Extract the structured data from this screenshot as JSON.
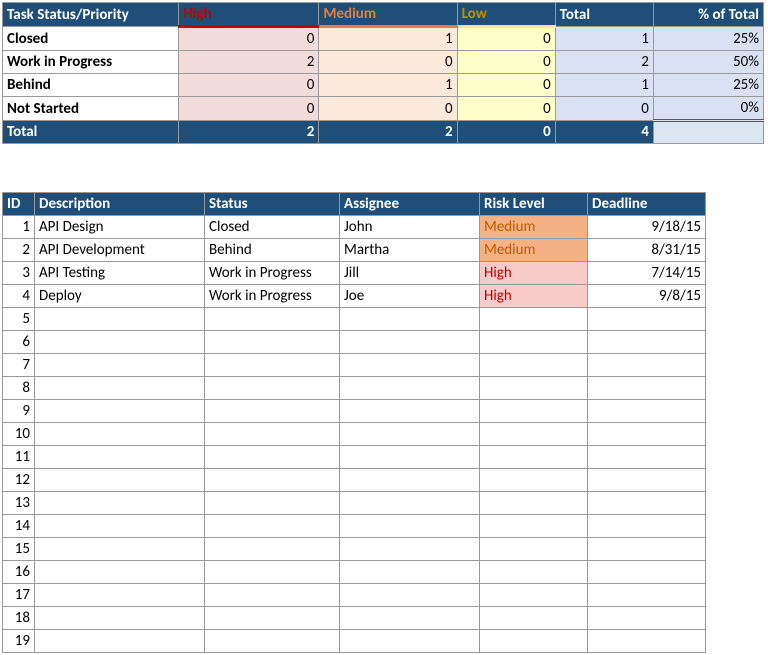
{
  "summary": {
    "headers": {
      "task": "Task Status/Priority",
      "high": "High",
      "medium": "Medium",
      "low": "Low",
      "total": "Total",
      "pct": "% of Total"
    },
    "rows": [
      {
        "label": "Closed",
        "high": "0",
        "medium": "1",
        "low": "0",
        "total": "1",
        "pct": "25%"
      },
      {
        "label": "Work in Progress",
        "high": "2",
        "medium": "0",
        "low": "0",
        "total": "2",
        "pct": "50%"
      },
      {
        "label": "Behind",
        "high": "0",
        "medium": "1",
        "low": "0",
        "total": "1",
        "pct": "25%"
      },
      {
        "label": "Not Started",
        "high": "0",
        "medium": "0",
        "low": "0",
        "total": "0",
        "pct": "0%"
      }
    ],
    "totals": {
      "label": "Total",
      "high": "2",
      "medium": "2",
      "low": "0",
      "total": "4",
      "pct": ""
    }
  },
  "detail": {
    "headers": {
      "id": "ID",
      "desc": "Description",
      "status": "Status",
      "assignee": "Assignee",
      "risk": "Risk Level",
      "deadline": "Deadline"
    },
    "rows": [
      {
        "id": "1",
        "desc": "API Design",
        "status": "Closed",
        "assignee": "John",
        "risk": "Medium",
        "riskClass": "risk-medium",
        "deadline": "9/18/15"
      },
      {
        "id": "2",
        "desc": "API Development",
        "status": "Behind",
        "assignee": "Martha",
        "risk": "Medium",
        "riskClass": "risk-medium",
        "deadline": "8/31/15"
      },
      {
        "id": "3",
        "desc": "API Testing",
        "status": "Work in Progress",
        "assignee": "Jill",
        "risk": "High",
        "riskClass": "risk-high",
        "deadline": "7/14/15"
      },
      {
        "id": "4",
        "desc": "Deploy",
        "status": "Work in Progress",
        "assignee": "Joe",
        "risk": "High",
        "riskClass": "risk-high",
        "deadline": "9/8/15"
      }
    ],
    "emptyIds": [
      "5",
      "6",
      "7",
      "8",
      "9",
      "10",
      "11",
      "12",
      "13",
      "14",
      "15",
      "16",
      "17",
      "18",
      "19"
    ]
  },
  "chart_data": {
    "type": "table",
    "title": "Task Status vs Priority Crosstab",
    "categories": [
      "Closed",
      "Work in Progress",
      "Behind",
      "Not Started"
    ],
    "series": [
      {
        "name": "High",
        "values": [
          0,
          2,
          0,
          0
        ]
      },
      {
        "name": "Medium",
        "values": [
          1,
          0,
          1,
          0
        ]
      },
      {
        "name": "Low",
        "values": [
          0,
          0,
          0,
          0
        ]
      }
    ],
    "row_totals": [
      1,
      2,
      1,
      0
    ],
    "pct_of_total": [
      25,
      50,
      25,
      0
    ],
    "column_totals": {
      "High": 2,
      "Medium": 2,
      "Low": 0,
      "Total": 4
    }
  }
}
